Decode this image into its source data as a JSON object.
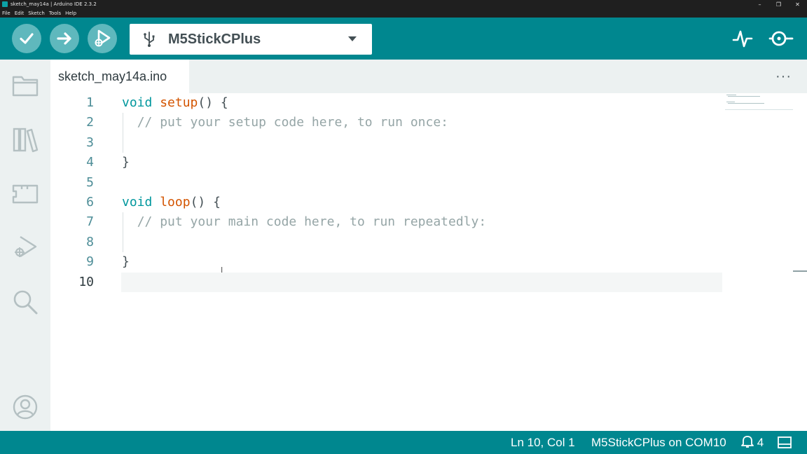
{
  "window": {
    "title": "sketch_may14a | Arduino IDE 2.3.2",
    "controls": [
      "minimize",
      "maximize",
      "close"
    ]
  },
  "menu": [
    "File",
    "Edit",
    "Sketch",
    "Tools",
    "Help"
  ],
  "toolbar": {
    "verify_icon": "checkmark-icon",
    "upload_icon": "arrow-right-icon",
    "debug_icon": "debug-icon",
    "board": "M5StickCPlus",
    "serial_plotter_icon": "pulse-icon",
    "serial_monitor_icon": "magnifier-icon"
  },
  "sidebar": {
    "items": [
      "folder-icon",
      "library-icon",
      "board-icon",
      "debug-icon",
      "search-icon"
    ],
    "account": "account-icon"
  },
  "tabs": [
    {
      "label": "sketch_may14a.ino",
      "active": true
    }
  ],
  "editor": {
    "lines": [
      {
        "num": "1",
        "parts": [
          {
            "t": "kw",
            "v": "void"
          },
          {
            "t": "txt",
            "v": " "
          },
          {
            "t": "fn",
            "v": "setup"
          },
          {
            "t": "txt",
            "v": "() {"
          }
        ]
      },
      {
        "num": "2",
        "parts": [
          {
            "t": "txt",
            "v": "  "
          },
          {
            "t": "cm",
            "v": "// put your setup code here, to run once:"
          }
        ]
      },
      {
        "num": "3",
        "parts": []
      },
      {
        "num": "4",
        "parts": [
          {
            "t": "txt",
            "v": "}"
          }
        ]
      },
      {
        "num": "5",
        "parts": []
      },
      {
        "num": "6",
        "parts": [
          {
            "t": "kw",
            "v": "void"
          },
          {
            "t": "txt",
            "v": " "
          },
          {
            "t": "fn",
            "v": "loop"
          },
          {
            "t": "txt",
            "v": "() {"
          }
        ]
      },
      {
        "num": "7",
        "parts": [
          {
            "t": "txt",
            "v": "  "
          },
          {
            "t": "cm",
            "v": "// put your main code here, to run repeatedly:"
          }
        ]
      },
      {
        "num": "8",
        "parts": []
      },
      {
        "num": "9",
        "parts": [
          {
            "t": "txt",
            "v": "}"
          }
        ]
      },
      {
        "num": "10",
        "parts": []
      }
    ],
    "active_line": "10"
  },
  "status": {
    "position": "Ln 10, Col 1",
    "board_port": "M5StickCPlus on COM10",
    "notifications": "4"
  },
  "colors": {
    "accent": "#00878f",
    "button": "#5fb8bd",
    "keyword": "#00979d",
    "function": "#d35400",
    "comment": "#95a5a6"
  }
}
